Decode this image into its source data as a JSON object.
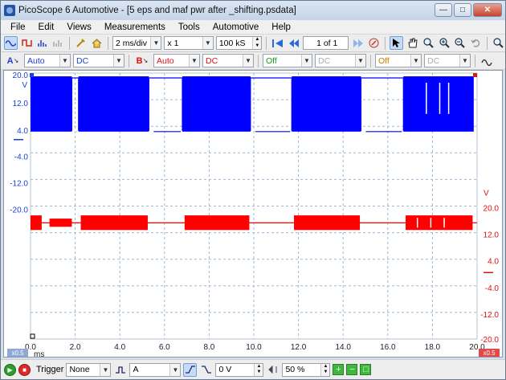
{
  "window": {
    "title": "PicoScope 6 Automotive - [5 eps and maf pwr after _shifting.psdata]",
    "controls": [
      "minimize",
      "maximize",
      "close"
    ]
  },
  "menu": [
    "File",
    "Edit",
    "Views",
    "Measurements",
    "Tools",
    "Automotive",
    "Help"
  ],
  "toolbar1": {
    "timebase": "2 ms/div",
    "zoom": "x 1",
    "samples": "100 kS",
    "buffer": "1 of 1"
  },
  "toolbar2": {
    "channel_a": {
      "label": "A",
      "range": "Auto",
      "coupling": "DC",
      "color": "#1a3fd6"
    },
    "channel_b": {
      "label": "B",
      "range": "Auto",
      "coupling": "DC",
      "color": "#e01010"
    },
    "channel_c": {
      "state": "Off",
      "coupling": "DC"
    },
    "channel_d": {
      "state": "Off",
      "coupling": "DC"
    }
  },
  "scope": {
    "left_axis_unit": "V",
    "right_axis_unit": "V",
    "left_ticks": [
      "20.0",
      "12.0",
      "4.0",
      "-4.0",
      "-12.0",
      "-20.0"
    ],
    "right_ticks": [
      "20.0",
      "12.0",
      "4.0",
      "-4.0",
      "-12.0",
      "-20.0"
    ],
    "x_ticks": [
      "0.0",
      "2.0",
      "4.0",
      "6.0",
      "8.0",
      "10.0",
      "12.0",
      "14.0",
      "16.0",
      "18.0",
      "20.0"
    ],
    "x_unit": "ms",
    "left_zoom_badge": "x0.5",
    "right_zoom_badge": "x0.5"
  },
  "colors": {
    "channel_a": "#0000ff",
    "channel_b": "#ff0000",
    "grid": "#9fb7d2"
  },
  "bottombar": {
    "trigger_label": "Trigger",
    "trigger_mode": "None",
    "trigger_source": "A",
    "trigger_level": "0 V",
    "pretrigger": "50 %"
  }
}
